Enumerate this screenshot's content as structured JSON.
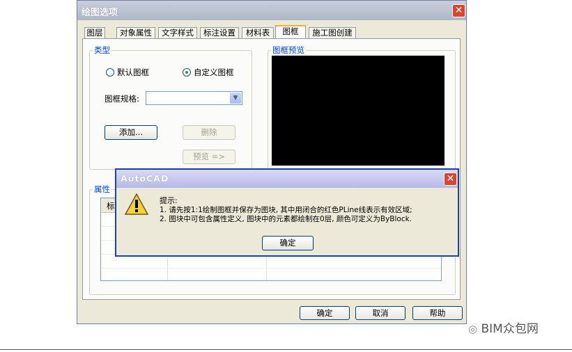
{
  "main": {
    "title": "绘图选项",
    "tabs": [
      "图层",
      "对象属性",
      "文字样式",
      "标注设置",
      "材料表",
      "图框",
      "施工图创建"
    ],
    "active_tab": "图框",
    "type_group": {
      "legend": "类型",
      "radio_default": "默认图框",
      "radio_custom": "自定义图框",
      "selected": "自定义图框"
    },
    "frame_spec_label": "图框规格:",
    "frame_spec_value": "",
    "add_button": "添加...",
    "delete_button": "删除",
    "preview_button": "预览 =>",
    "preview_legend": "图框预览",
    "attr_legend": "属性",
    "attr_col_header": "标",
    "ok_button": "确定",
    "cancel_button": "取消",
    "help_button": "帮助"
  },
  "alert": {
    "title": "AutoCAD",
    "heading": "提示:",
    "line1": "1. 请先按1:1绘制图框并保存为图块, 其中用闭合的红色PLine线表示有效区域;",
    "line2": "2. 图块中可包含属性定义, 图块中的元素都绘制在0层, 颜色可定义为ByBlock.",
    "ok_button": "确定",
    "icon": "warning-icon"
  },
  "watermark": "BIM众包网",
  "colors": {
    "preview_bg": "#000000",
    "close_red": "#d9462c",
    "alert_border": "#1c3fa8",
    "tab_highlight": "#f6b032"
  }
}
